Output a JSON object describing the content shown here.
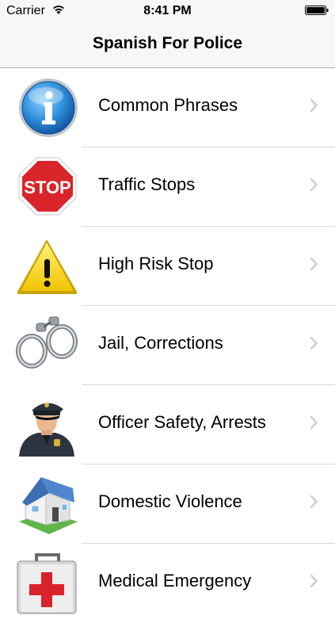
{
  "status_bar": {
    "carrier": "Carrier",
    "time": "8:41 PM"
  },
  "nav": {
    "title": "Spanish For Police"
  },
  "menu": [
    {
      "label": "Common Phrases",
      "icon": "info-icon"
    },
    {
      "label": "Traffic Stops",
      "icon": "stop-sign-icon",
      "icon_text": "STOP"
    },
    {
      "label": "High Risk Stop",
      "icon": "warning-icon"
    },
    {
      "label": "Jail, Corrections",
      "icon": "handcuffs-icon"
    },
    {
      "label": "Officer Safety, Arrests",
      "icon": "police-officer-icon"
    },
    {
      "label": "Domestic Violence",
      "icon": "house-icon"
    },
    {
      "label": "Medical Emergency",
      "icon": "first-aid-kit-icon"
    }
  ]
}
